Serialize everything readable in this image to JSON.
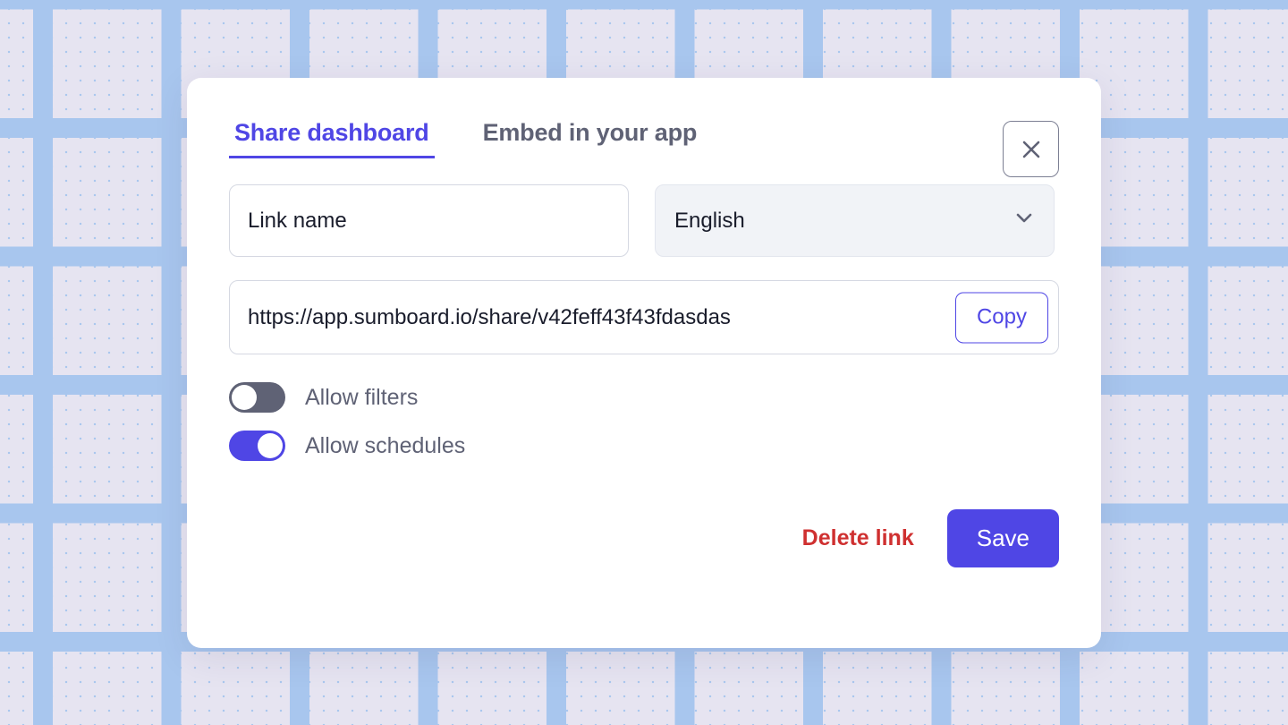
{
  "background": {
    "base_color": "#E6E4F1",
    "dot_color": "#A8C6EE"
  },
  "theme": {
    "accent": "#4F46E5",
    "danger": "#CF3030",
    "muted_text": "#5F6275",
    "text": "#191C2B",
    "field_border": "#D5D8E2",
    "select_fill": "#F1F3F7"
  },
  "dialog": {
    "tabs": [
      {
        "label": "Share dashboard",
        "active": true
      },
      {
        "label": "Embed in your app",
        "active": false
      }
    ],
    "close_icon": "close-icon",
    "link_name": {
      "value": "Link name",
      "placeholder": "Link name"
    },
    "language": {
      "value": "English",
      "chevron_icon": "chevron-down-icon"
    },
    "share_url": {
      "value": "https://app.sumboard.io/share/v42feff43f43fdasdas",
      "copy_label": "Copy"
    },
    "toggles": [
      {
        "label": "Allow filters",
        "on": false
      },
      {
        "label": "Allow schedules",
        "on": true
      }
    ],
    "footer": {
      "delete_label": "Delete link",
      "save_label": "Save"
    }
  }
}
